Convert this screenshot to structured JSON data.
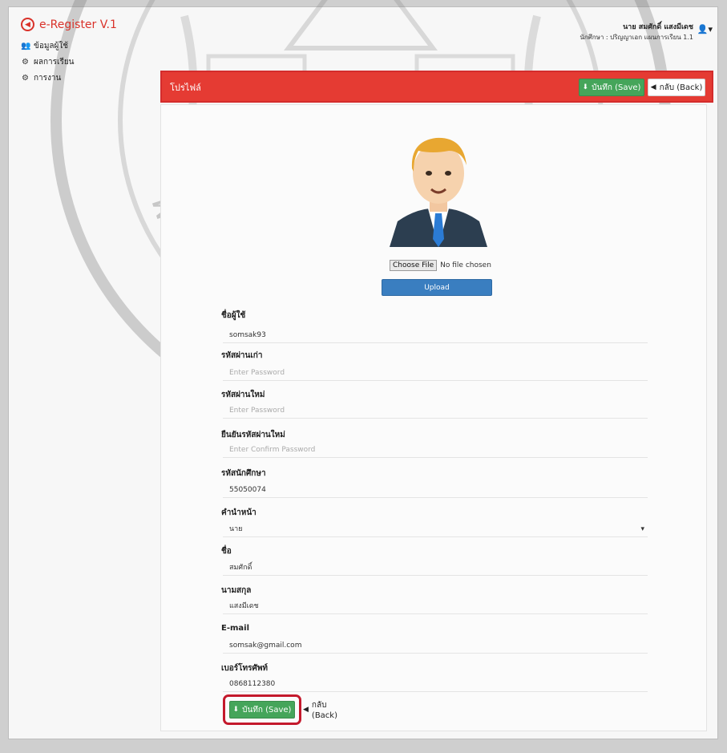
{
  "app": {
    "brand": "e-Register V.1",
    "logo_glyph": "◀"
  },
  "sidebar": {
    "items": [
      {
        "icon": "users-icon",
        "glyph": "👥",
        "label": "ข้อมูลผู้ใช้"
      },
      {
        "icon": "gears-icon",
        "glyph": "⚙",
        "label": "ผลการเรียน"
      },
      {
        "icon": "gears-icon",
        "glyph": "⚙",
        "label": "การงาน"
      }
    ]
  },
  "user": {
    "name": "นาย สมศักดิ์ แสงมีเดช",
    "role": "นักศึกษา : ปริญญาเอก แผนการเรียน 1.1",
    "menu_glyph": "👤▾"
  },
  "header": {
    "title": "โปรไฟล์",
    "save_label": "บันทึก (Save)",
    "back_label": "กลับ (Back)",
    "save_glyph": "⬇",
    "back_glyph": "◀"
  },
  "profile_image": {
    "choose_file_label": "Choose File",
    "file_status": "No file chosen",
    "upload_label": "Upload"
  },
  "form": {
    "username": {
      "label": "ชื่อผู้ใช้",
      "value": "somsak93"
    },
    "old_password": {
      "label": "รหัสผ่านเก่า",
      "placeholder": "Enter Password"
    },
    "new_password": {
      "label": "รหัสผ่านใหม่",
      "placeholder": "Enter Password"
    },
    "confirm_password": {
      "label": "ยืนยันรหัสผ่านใหม่",
      "placeholder": "Enter Confirm Password"
    },
    "student_id": {
      "label": "รหัสนักศึกษา",
      "value": "55050074"
    },
    "prefix": {
      "label": "คำนำหน้า",
      "value": "นาย"
    },
    "first_name": {
      "label": "ชื่อ",
      "value": "สมศักดิ์"
    },
    "last_name": {
      "label": "นามสกุล",
      "value": "แสงมีเดช"
    },
    "email": {
      "label": "E-mail",
      "value": "somsak@gmail.com"
    },
    "phone": {
      "label": "เบอร์โทรศัพท์",
      "value": "0868112380"
    }
  },
  "footer": {
    "save_label": "บันทึก (Save)",
    "back_label": "กลับ (Back)"
  },
  "watermark": {
    "text": "พระจอมเกล้าเจ้าคุณทหาร"
  },
  "colors": {
    "header_red": "#e53b33",
    "save_green": "#45a55a",
    "upload_blue": "#3a7ec0",
    "highlight_red": "#c4192c",
    "brand_red": "#d9322a"
  }
}
